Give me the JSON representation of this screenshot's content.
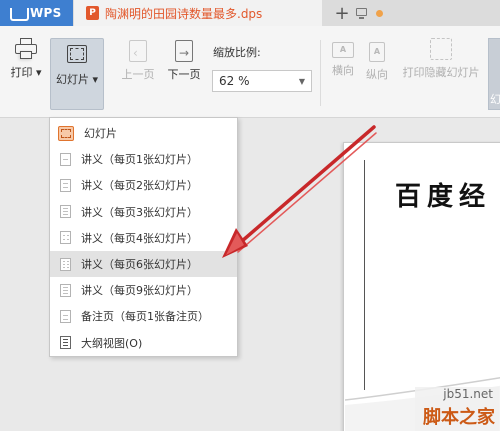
{
  "titlebar": {
    "app_name": "WPS",
    "document_title": "陶渊明的田园诗数量最多.dps",
    "new_tab": "+"
  },
  "toolbar": {
    "print_label": "打印",
    "slides_label": "幻灯片",
    "prev_label": "上一页",
    "next_label": "下一页",
    "zoom_label": "缩放比例:",
    "zoom_value": "62 %",
    "landscape_label": "横向",
    "portrait_label": "纵向",
    "print_hidden_label": "打印隐藏幻灯片"
  },
  "dropdown": {
    "items": [
      {
        "label": "幻灯片",
        "icon": "slide-icon"
      },
      {
        "label": "讲义（每页1张幻灯片）",
        "icon": "handout-icon"
      },
      {
        "label": "讲义（每页2张幻灯片）",
        "icon": "handout-icon"
      },
      {
        "label": "讲义（每页3张幻灯片）",
        "icon": "handout-icon"
      },
      {
        "label": "讲义（每页4张幻灯片）",
        "icon": "handout-icon"
      },
      {
        "label": "讲义（每页6张幻灯片）",
        "icon": "handout-icon",
        "highlighted": true
      },
      {
        "label": "讲义（每页9张幻灯片）",
        "icon": "handout-icon"
      },
      {
        "label": "备注页（每页1张备注页）",
        "icon": "notes-icon"
      },
      {
        "label": "大纲视图(O)",
        "icon": "outline-icon"
      }
    ]
  },
  "preview": {
    "slide_title": "百度经"
  },
  "watermark": {
    "site": "jb51.net",
    "brand": "脚本之家"
  },
  "colors": {
    "wps_blue": "#3e7fd0",
    "doc_orange": "#e2582c",
    "arrow_red": "#c8282a",
    "brand_orange": "#cc5a16"
  }
}
